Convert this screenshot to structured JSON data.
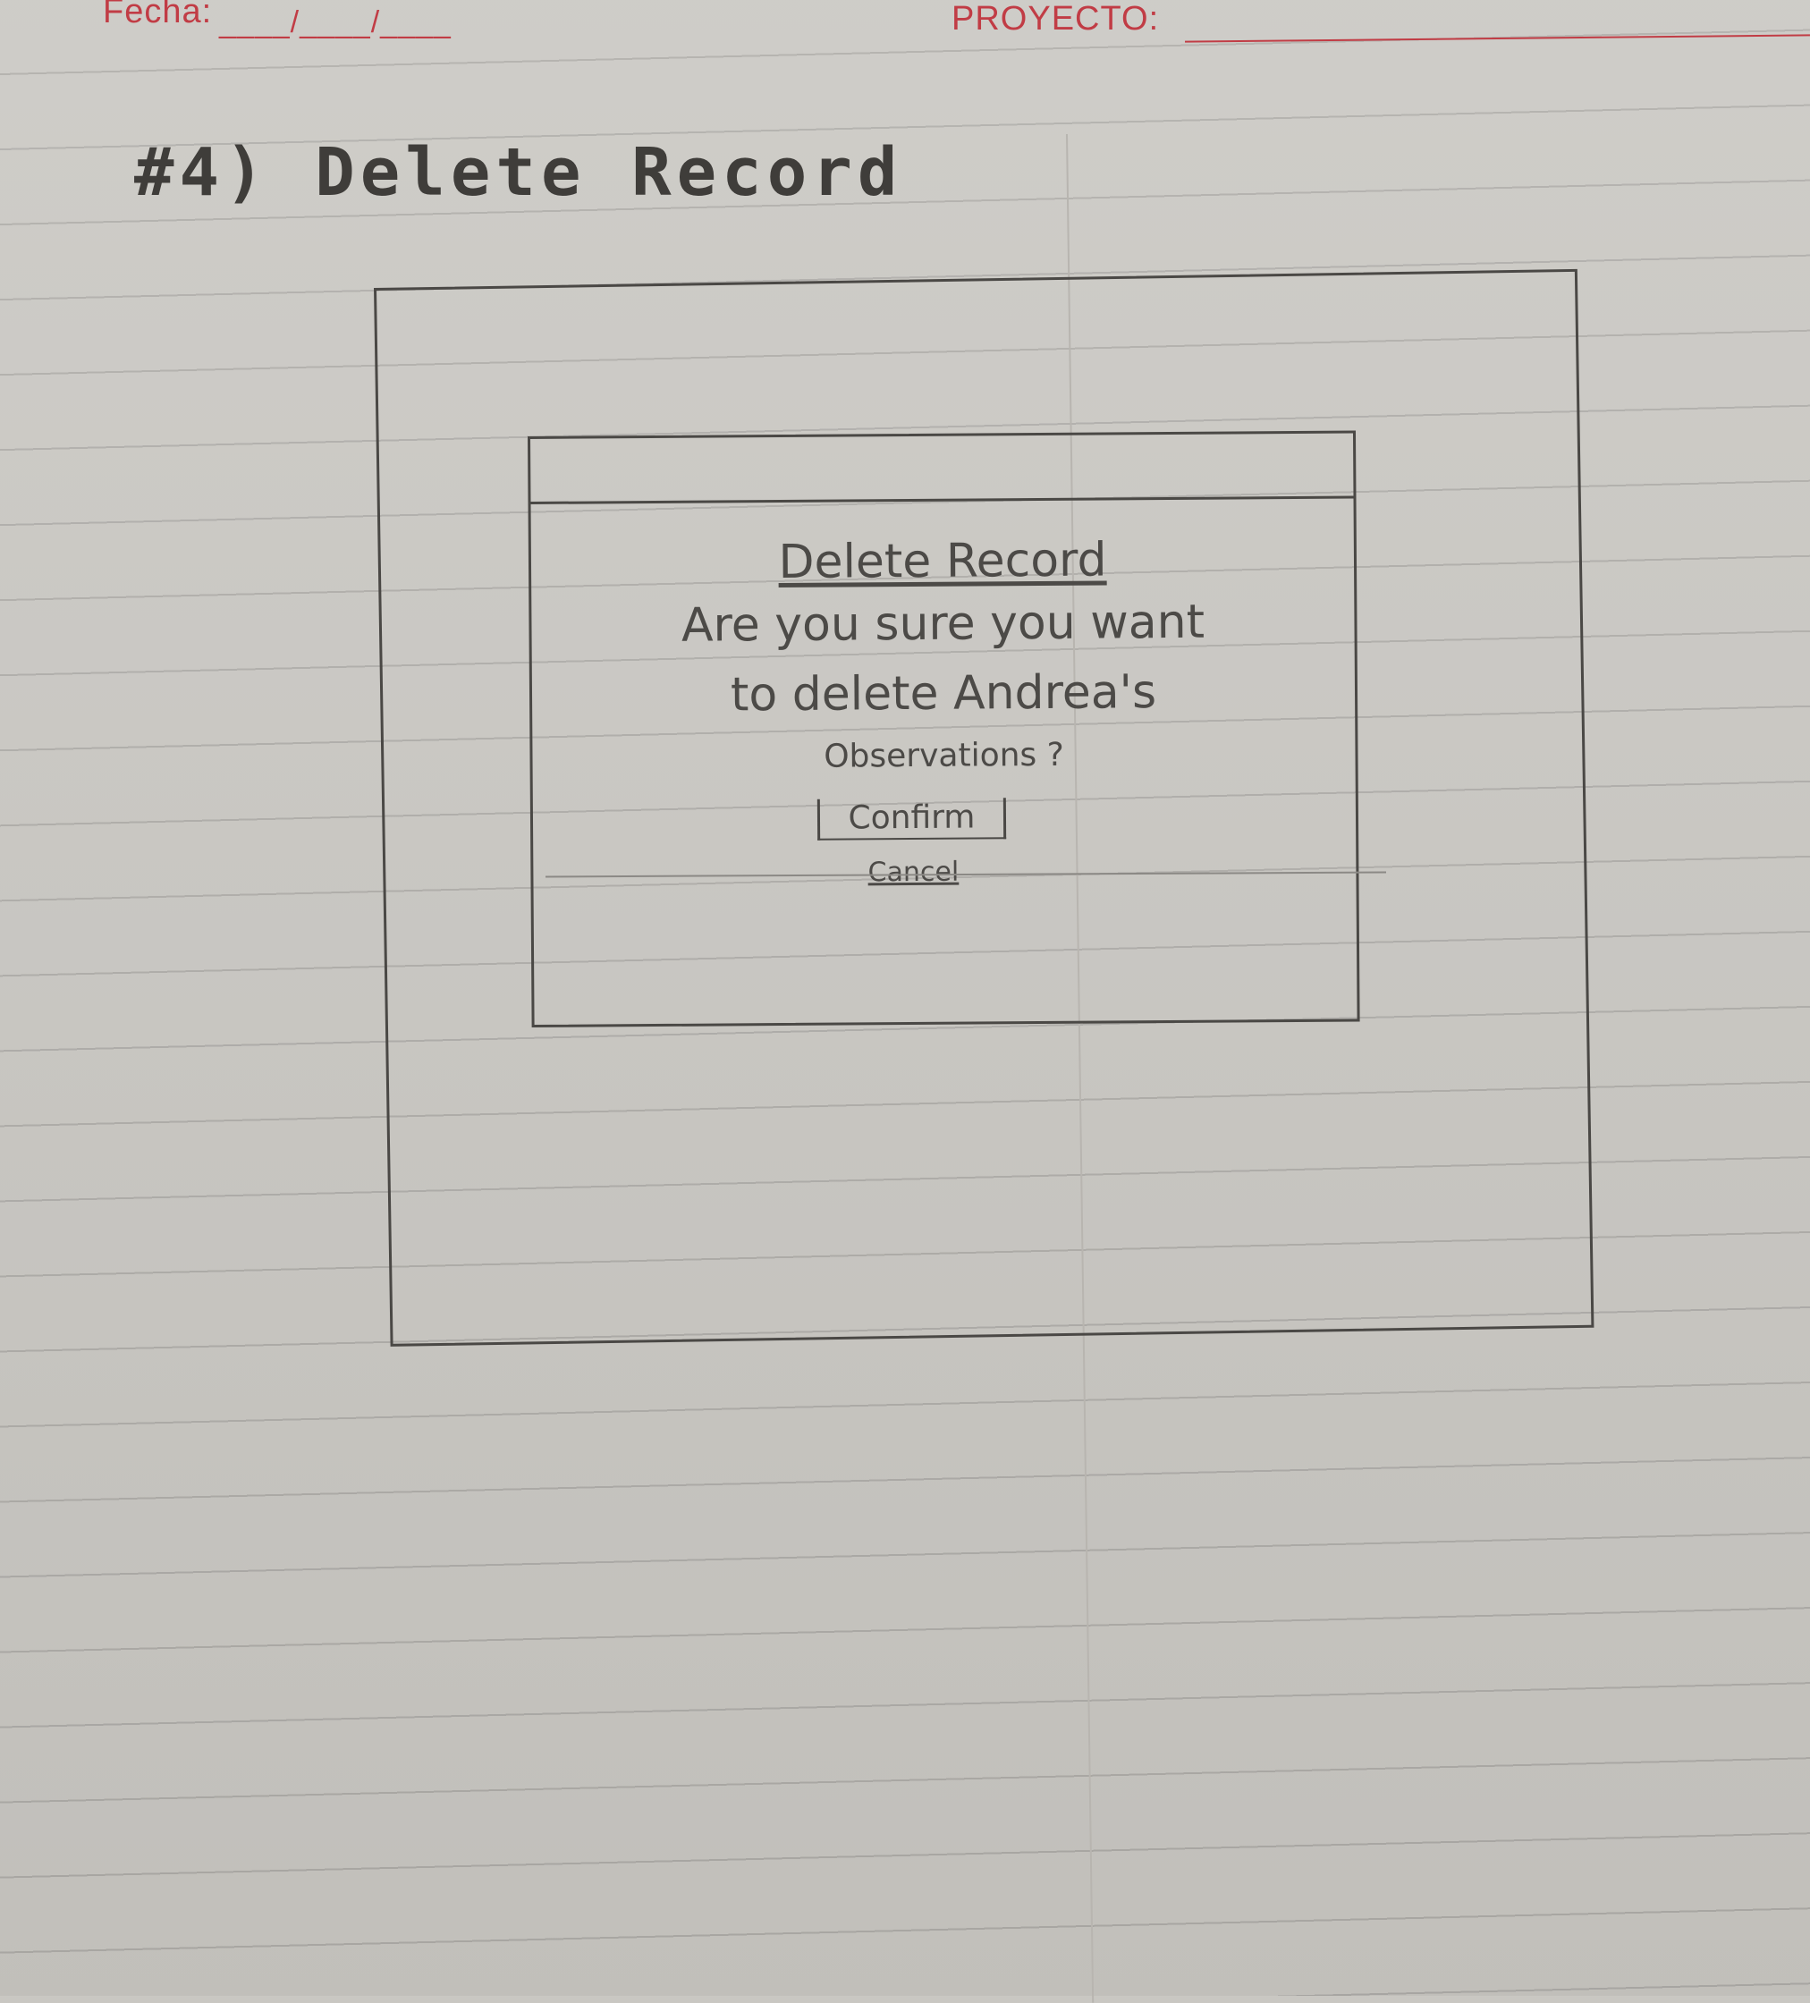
{
  "header": {
    "date_label": "Fecha:",
    "date_blanks": "____/____/____",
    "project_label": "PROYECTO:"
  },
  "page": {
    "heading": "#4) Delete Record"
  },
  "dialog": {
    "title": "Delete Record",
    "message_line_1": "Are you sure you want",
    "message_line_2": "to delete Andrea's",
    "message_line_3": "Observations ?",
    "confirm_label": "Confirm",
    "cancel_label": "Cancel"
  },
  "colors": {
    "paper": "#c9c7c2",
    "ruled_line": "#aeaca8",
    "header_red": "#c13c45",
    "pencil": "#4a4845"
  }
}
